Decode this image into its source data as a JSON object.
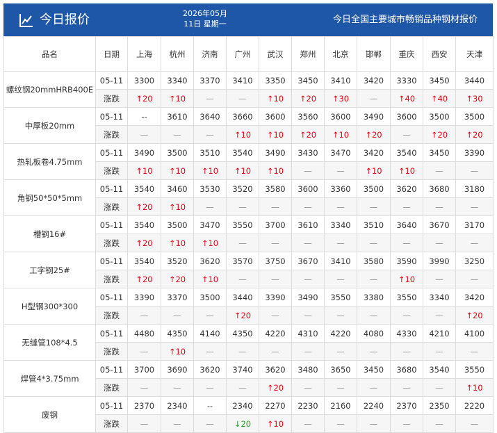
{
  "header": {
    "title": "今日报价",
    "date_line1": "2026年05月",
    "date_line2": "11日 星期一",
    "subtitle": "今日全国主要城市畅销品种钢材报价"
  },
  "colors": {
    "header_bg": "#1f57a8",
    "up": "#e60012",
    "down": "#19a319"
  },
  "table": {
    "name_header": "品名",
    "date_header": "日期",
    "cities": [
      "上海",
      "杭州",
      "济南",
      "广州",
      "武汉",
      "郑州",
      "北京",
      "邯郸",
      "重庆",
      "西安",
      "天津"
    ],
    "change_label": "涨跌",
    "products": [
      {
        "name": "螺纹钢20mmHRB400E",
        "date": "05-11",
        "prices": [
          "3300",
          "3340",
          "3370",
          "3410",
          "3350",
          "3450",
          "3410",
          "3420",
          "3330",
          "3450",
          "3440"
        ],
        "changes": [
          "↑20",
          "↑10",
          "—",
          "—",
          "↑10",
          "↑20",
          "↑30",
          "—",
          "↑40",
          "↑40",
          "↑30"
        ]
      },
      {
        "name": "中厚板20mm",
        "date": "05-11",
        "prices": [
          "--",
          "3610",
          "3640",
          "3660",
          "3600",
          "3560",
          "3600",
          "3490",
          "3600",
          "3500",
          "3500"
        ],
        "changes": [
          "—",
          "—",
          "—",
          "↑10",
          "↑10",
          "↑20",
          "↑10",
          "↑20",
          "—",
          "↑20",
          "↑20"
        ]
      },
      {
        "name": "热轧板卷4.75mm",
        "date": "05-11",
        "prices": [
          "3490",
          "3500",
          "3510",
          "3540",
          "3490",
          "3430",
          "3470",
          "3420",
          "3540",
          "3450",
          "3390"
        ],
        "changes": [
          "↑10",
          "↑10",
          "↑10",
          "↑10",
          "↑10",
          "—",
          "—",
          "↑10",
          "↑10",
          "—",
          "—"
        ]
      },
      {
        "name": "角钢50*50*5mm",
        "date": "05-11",
        "prices": [
          "3540",
          "3460",
          "3530",
          "3520",
          "3580",
          "3600",
          "3360",
          "3500",
          "3620",
          "3680",
          "3180"
        ],
        "changes": [
          "↑20",
          "↑10",
          "—",
          "—",
          "—",
          "—",
          "—",
          "—",
          "—",
          "—",
          "—"
        ]
      },
      {
        "name": "槽钢16#",
        "date": "05-11",
        "prices": [
          "3540",
          "3500",
          "3470",
          "3550",
          "3700",
          "3610",
          "3340",
          "3510",
          "3640",
          "3670",
          "3170"
        ],
        "changes": [
          "↑20",
          "↑10",
          "↑10",
          "—",
          "—",
          "—",
          "—",
          "—",
          "—",
          "—",
          "—"
        ]
      },
      {
        "name": "工字钢25#",
        "date": "05-11",
        "prices": [
          "3540",
          "3520",
          "3620",
          "3570",
          "3750",
          "3670",
          "3410",
          "3580",
          "3590",
          "3990",
          "3250"
        ],
        "changes": [
          "↑20",
          "↑20",
          "↑10",
          "—",
          "—",
          "—",
          "—",
          "—",
          "↑10",
          "—",
          "—"
        ]
      },
      {
        "name": "H型钢300*300",
        "date": "05-11",
        "prices": [
          "3390",
          "3370",
          "3500",
          "3440",
          "3390",
          "3490",
          "3550",
          "3380",
          "3550",
          "3340",
          "3420"
        ],
        "changes": [
          "—",
          "—",
          "—",
          "↑20",
          "—",
          "—",
          "—",
          "—",
          "—",
          "—",
          "↑20"
        ]
      },
      {
        "name": "无缝管108*4.5",
        "date": "05-11",
        "prices": [
          "4480",
          "4350",
          "4140",
          "4350",
          "4220",
          "4310",
          "4220",
          "4080",
          "4330",
          "4210",
          "4100"
        ],
        "changes": [
          "—",
          "↑10",
          "—",
          "—",
          "—",
          "—",
          "—",
          "—",
          "—",
          "—",
          "—"
        ]
      },
      {
        "name": "焊管4*3.75mm",
        "date": "05-11",
        "prices": [
          "3700",
          "3690",
          "3620",
          "3740",
          "3620",
          "3480",
          "3650",
          "3450",
          "3680",
          "3540",
          "3550"
        ],
        "changes": [
          "—",
          "—",
          "—",
          "—",
          "↑20",
          "—",
          "—",
          "—",
          "—",
          "—",
          "↑10"
        ]
      },
      {
        "name": "废钢",
        "date": "05-11",
        "prices": [
          "2370",
          "2340",
          "--",
          "2340",
          "2270",
          "2230",
          "2160",
          "2240",
          "2370",
          "2350",
          "2220"
        ],
        "changes": [
          "—",
          "—",
          "—",
          "↓20",
          "↑10",
          "—",
          "—",
          "—",
          "—",
          "—",
          "—"
        ]
      }
    ]
  }
}
